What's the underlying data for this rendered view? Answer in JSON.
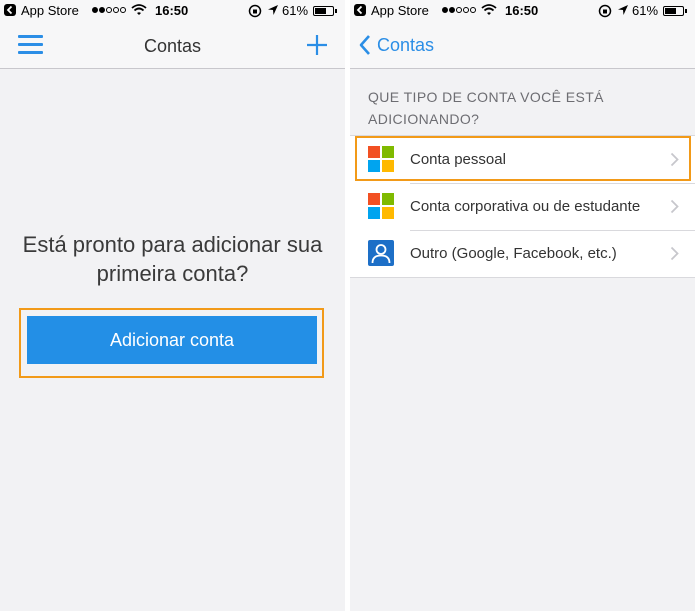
{
  "status_bar": {
    "carrier": "App Store",
    "time": "16:50",
    "battery_percent": "61%",
    "battery_level": 0.61,
    "signal_bars_filled": 2,
    "signal_bars_total": 5
  },
  "left_screen": {
    "title": "Contas",
    "prompt": "Está pronto para adicionar sua primeira conta?",
    "add_button_label": "Adicionar conta"
  },
  "right_screen": {
    "back_label": "Contas",
    "section_header": "QUE TIPO DE CONTA VOCÊ ESTÁ ADICIONANDO?",
    "options": [
      {
        "label": "Conta pessoal",
        "icon": "microsoft-logo-icon"
      },
      {
        "label": "Conta corporativa ou de estudante",
        "icon": "microsoft-logo-icon"
      },
      {
        "label": "Outro (Google, Facebook, etc.)",
        "icon": "person-icon"
      }
    ]
  },
  "colors": {
    "accent": "#2b8ee6",
    "highlight": "#f29a18",
    "button": "#238fe6",
    "ms_red": "#f25022",
    "ms_green": "#7fba00",
    "ms_blue": "#00a4ef",
    "ms_yellow": "#ffb900"
  }
}
